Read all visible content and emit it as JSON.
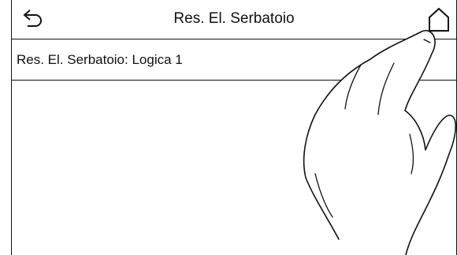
{
  "header": {
    "title": "Res. El. Serbatoio"
  },
  "setting": {
    "label": "Res. El. Serbatoio: Logica 1"
  },
  "icons": {
    "back": "back-arrow-icon",
    "home": "home-icon",
    "hand": "hand-pointer-icon"
  }
}
